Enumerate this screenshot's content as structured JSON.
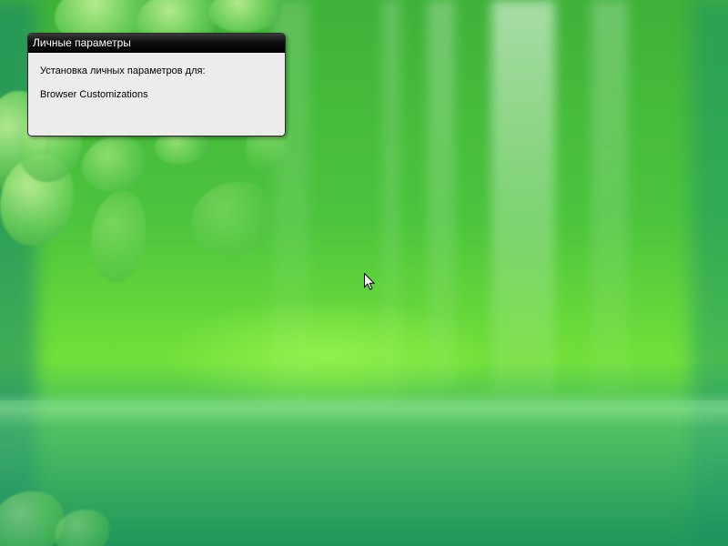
{
  "wallpaper": {
    "name": "green-nature-wallpaper",
    "colors": {
      "primary": "#4cc43d",
      "highlight": "#72e03a",
      "deep": "#2fa25a"
    }
  },
  "dialog": {
    "title": "Личные параметры",
    "line1": "Установка личных параметров для:",
    "line2": "Browser Customizations"
  },
  "cursor": {
    "icon": "arrow-pointer-icon"
  }
}
